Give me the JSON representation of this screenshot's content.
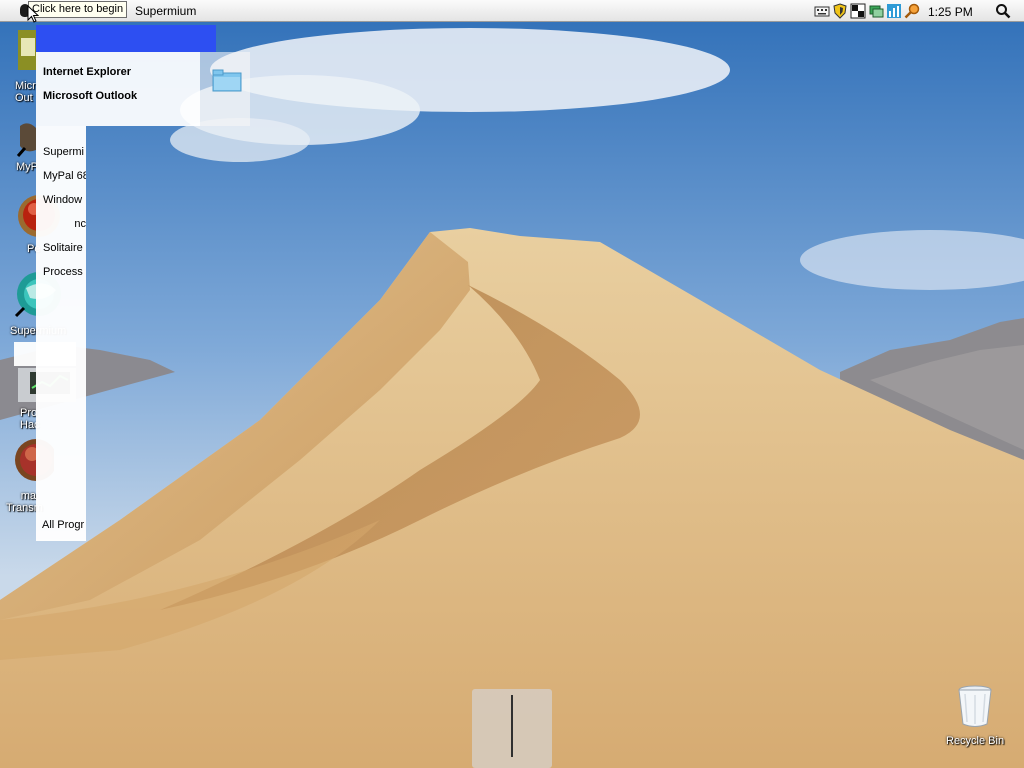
{
  "menubar": {
    "tooltip": "Click here to begin",
    "active_app": "Supermium",
    "tray_icons": [
      "keyboard-icon",
      "shield-icon",
      "display-grid-icon",
      "network-icon",
      "chart-icon",
      "magnifier-key-icon"
    ],
    "clock": "1:25 PM",
    "spotlight_icon": "search-icon"
  },
  "start_menu": {
    "pinned": [
      "Internet Explorer",
      "Microsoft Outlook"
    ],
    "recent": [
      "Supermi",
      "MyPal 68",
      "Window",
      "nc",
      "Solitaire",
      "Process I"
    ],
    "all_programs": "All Progr"
  },
  "desktop": {
    "icons": [
      {
        "name": "outlook",
        "label": "Micr\nOut"
      },
      {
        "name": "mypal",
        "label": "MyP"
      },
      {
        "name": "pe",
        "label": "Pe"
      },
      {
        "name": "supermium",
        "label": "Supermium"
      },
      {
        "name": "process-hacker",
        "label": "Pro\nHac"
      },
      {
        "name": "transmission",
        "label": "ma\nTransm"
      }
    ],
    "recycle_bin": "Recycle Bin"
  },
  "colors": {
    "start_header": "#2d4ff2",
    "menubar": "#ececec",
    "sky_top": "#2f6fb8",
    "dune": "#d9b27a"
  }
}
